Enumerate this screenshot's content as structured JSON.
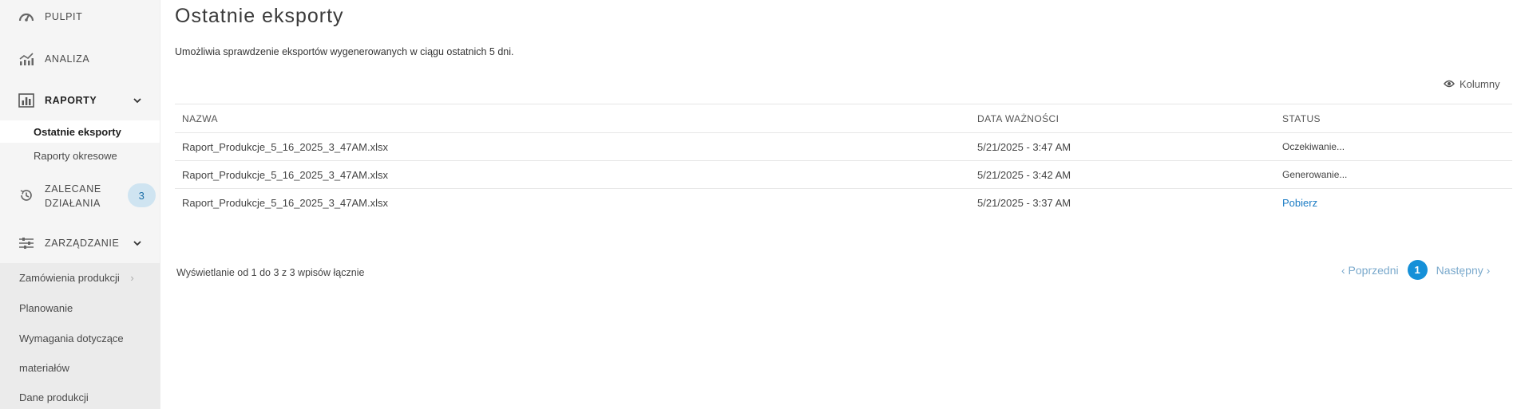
{
  "sidebar": {
    "items": [
      {
        "label": "PULPIT",
        "icon": "gauge-icon"
      },
      {
        "label": "ANALIZA",
        "icon": "chart-trend-icon"
      },
      {
        "label": "RAPORTY",
        "icon": "report-bars-icon"
      },
      {
        "label": "ZALECANE\nDZIAŁANIA",
        "icon": "history-icon",
        "badge": "3"
      },
      {
        "label": "ZARZĄDZANIE",
        "icon": "sliders-icon"
      }
    ],
    "report_subitems": [
      "Ostatnie eksporty",
      "Raporty okresowe"
    ],
    "management_items": [
      "Zamówienia produkcji",
      "Planowanie",
      "Wymagania dotyczące",
      "materiałów",
      "Dane produkcji"
    ]
  },
  "main": {
    "title": "Ostatnie eksporty",
    "description": "Umożliwia sprawdzenie eksportów wygenerowanych w ciągu ostatnich 5 dni.",
    "columns_button": "Kolumny",
    "table": {
      "headers": [
        "NAZWA",
        "DATA WAŻNOŚCI",
        "STATUS"
      ],
      "rows": [
        {
          "name": "Raport_Produkcje_5_16_2025_3_47AM.xlsx",
          "expiry": "5/21/2025 - 3:47 AM",
          "status": "Oczekiwanie..."
        },
        {
          "name": "Raport_Produkcje_5_16_2025_3_47AM.xlsx",
          "expiry": "5/21/2025 - 3:42 AM",
          "status": "Generowanie..."
        },
        {
          "name": "Raport_Produkcje_5_16_2025_3_47AM.xlsx",
          "expiry": "5/21/2025 - 3:37 AM",
          "status": "Pobierz"
        }
      ]
    },
    "footer_info": "Wyświetlanie od 1 do 3 z 3 wpisów łącznie",
    "pagination": {
      "prev": "‹ Poprzedni",
      "current": "1",
      "next": "Następny ›"
    }
  },
  "colors": {
    "accent": "#1590d8",
    "link": "#1a7bc4",
    "badge_bg": "#cfe4f1",
    "sidebar_bg": "#f5f5f5"
  }
}
